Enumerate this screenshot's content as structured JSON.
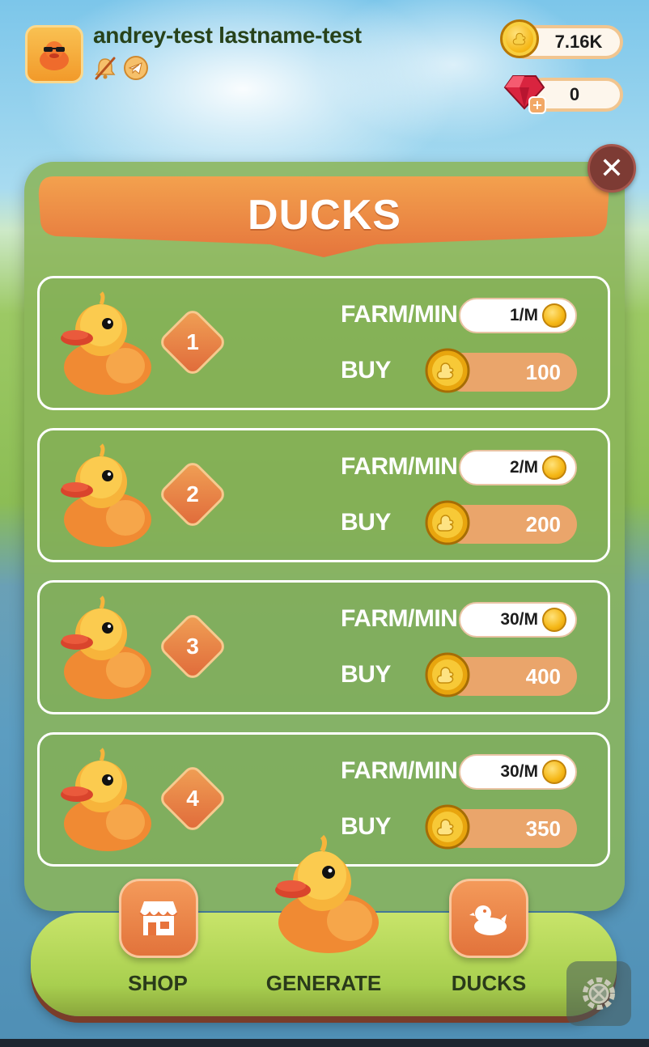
{
  "header": {
    "username": "andrey-test lastname-test",
    "coins": "7.16K",
    "gems": "0"
  },
  "icons": {
    "avatar": "duck-with-sunglasses-icon",
    "notifications": "bell-muted-icon",
    "telegram": "telegram-icon",
    "coin": "duck-coin-icon",
    "gem": "ruby-gem-icon",
    "close": "close-icon",
    "shop": "shop-storefront-icon",
    "ducks": "duck-icon",
    "settings": "gear-icon"
  },
  "panel": {
    "title": "DUCKS",
    "close_label": "✕",
    "farm_label": "FARM/MIN",
    "buy_label": "BUY",
    "ducks": [
      {
        "level": "1",
        "farm": "1/M",
        "price": "100"
      },
      {
        "level": "2",
        "farm": "2/M",
        "price": "200"
      },
      {
        "level": "3",
        "farm": "30/M",
        "price": "400"
      },
      {
        "level": "4",
        "farm": "30/M",
        "price": "350"
      }
    ]
  },
  "nav": {
    "shop": "SHOP",
    "generate": "GENERATE",
    "ducks": "DUCKS"
  },
  "colors": {
    "panel": "#8bb55a",
    "accent_orange": "#e6733b",
    "coin_gold": "#f5b716",
    "close": "#7d3b34"
  }
}
